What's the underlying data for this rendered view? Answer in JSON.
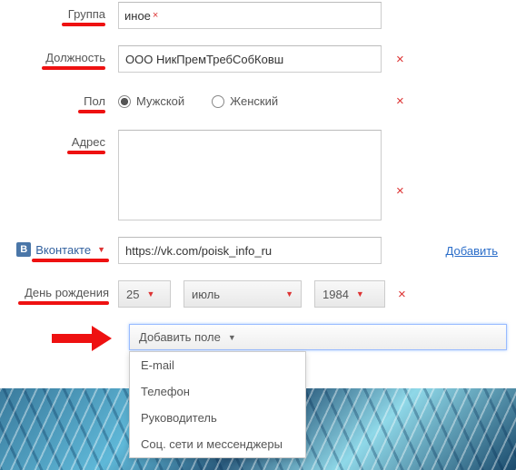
{
  "fields": {
    "group": {
      "label": "Группа",
      "value": "иное"
    },
    "position": {
      "label": "Должность",
      "value": "ООО НикПремТребСобКовш"
    },
    "gender": {
      "label": "Пол",
      "male": "Мужской",
      "female": "Женский"
    },
    "address": {
      "label": "Адрес",
      "value": ""
    },
    "vk": {
      "label": "Вконтакте",
      "value": "https://vk.com/poisk_info_ru",
      "add_link": "Добавить"
    },
    "birthday": {
      "label": "День рождения",
      "day": "25",
      "month": "июль",
      "year": "1984"
    }
  },
  "add_field": {
    "button": "Добавить поле",
    "options": [
      "E-mail",
      "Телефон",
      "Руководитель",
      "Соц. сети и мессенджеры"
    ]
  }
}
